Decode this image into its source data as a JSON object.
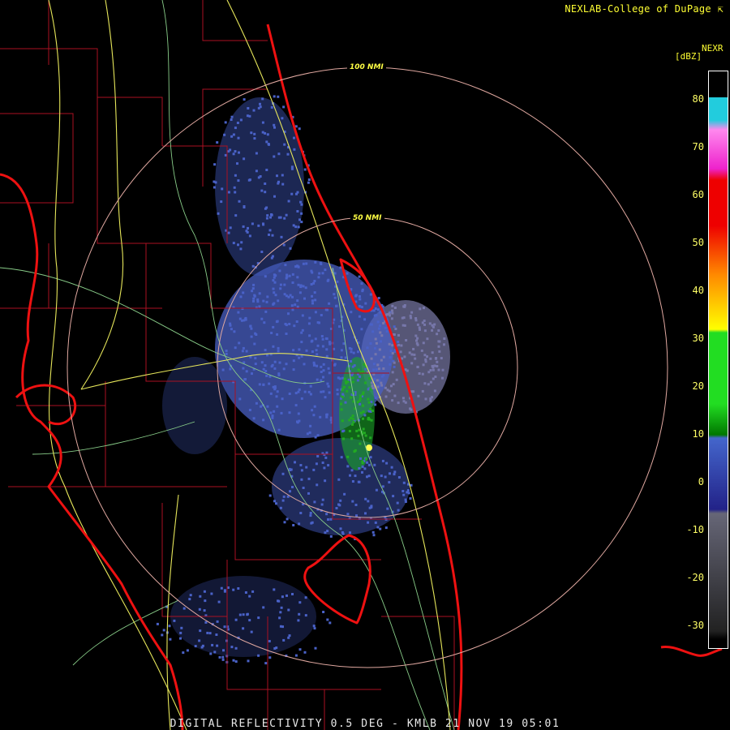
{
  "header": {
    "credit": "NEXLAB-College of DuPage",
    "credit_icon": "external-link-icon",
    "product": "NEXR",
    "unit": "[dBZ]"
  },
  "footer": {
    "caption": "DIGITAL REFLECTIVITY 0.5 DEG - KMLB 21 NOV 19 05:01"
  },
  "range_rings": [
    {
      "label": "100 NMI"
    },
    {
      "label": "50 NMI"
    }
  ],
  "legend": {
    "ticks": [
      "80",
      "70",
      "60",
      "50",
      "40",
      "30",
      "20",
      "10",
      "0",
      "-10",
      "-20",
      "-30"
    ],
    "colors": {
      "cyan": "#22ccdd",
      "magenta": "#ee22cc",
      "red": "#ee0000",
      "orange": "#ff8800",
      "yellow": "#ffff00",
      "green": "#22dd22",
      "dark_green": "#007700",
      "blue": "#4466cc",
      "navy": "#222288",
      "gray": "#666677",
      "dark_gray": "#222222"
    }
  },
  "map_colors": {
    "coast": "#ee1111",
    "county_lines": "#aa1122",
    "highways": "#e6e65a",
    "roads": "#88cc88",
    "range_ring": "#e0a8a0",
    "echo_weak": "#4a62c8",
    "echo_clear_air": "#7777aa",
    "echo_moderate": "#22aa22"
  }
}
